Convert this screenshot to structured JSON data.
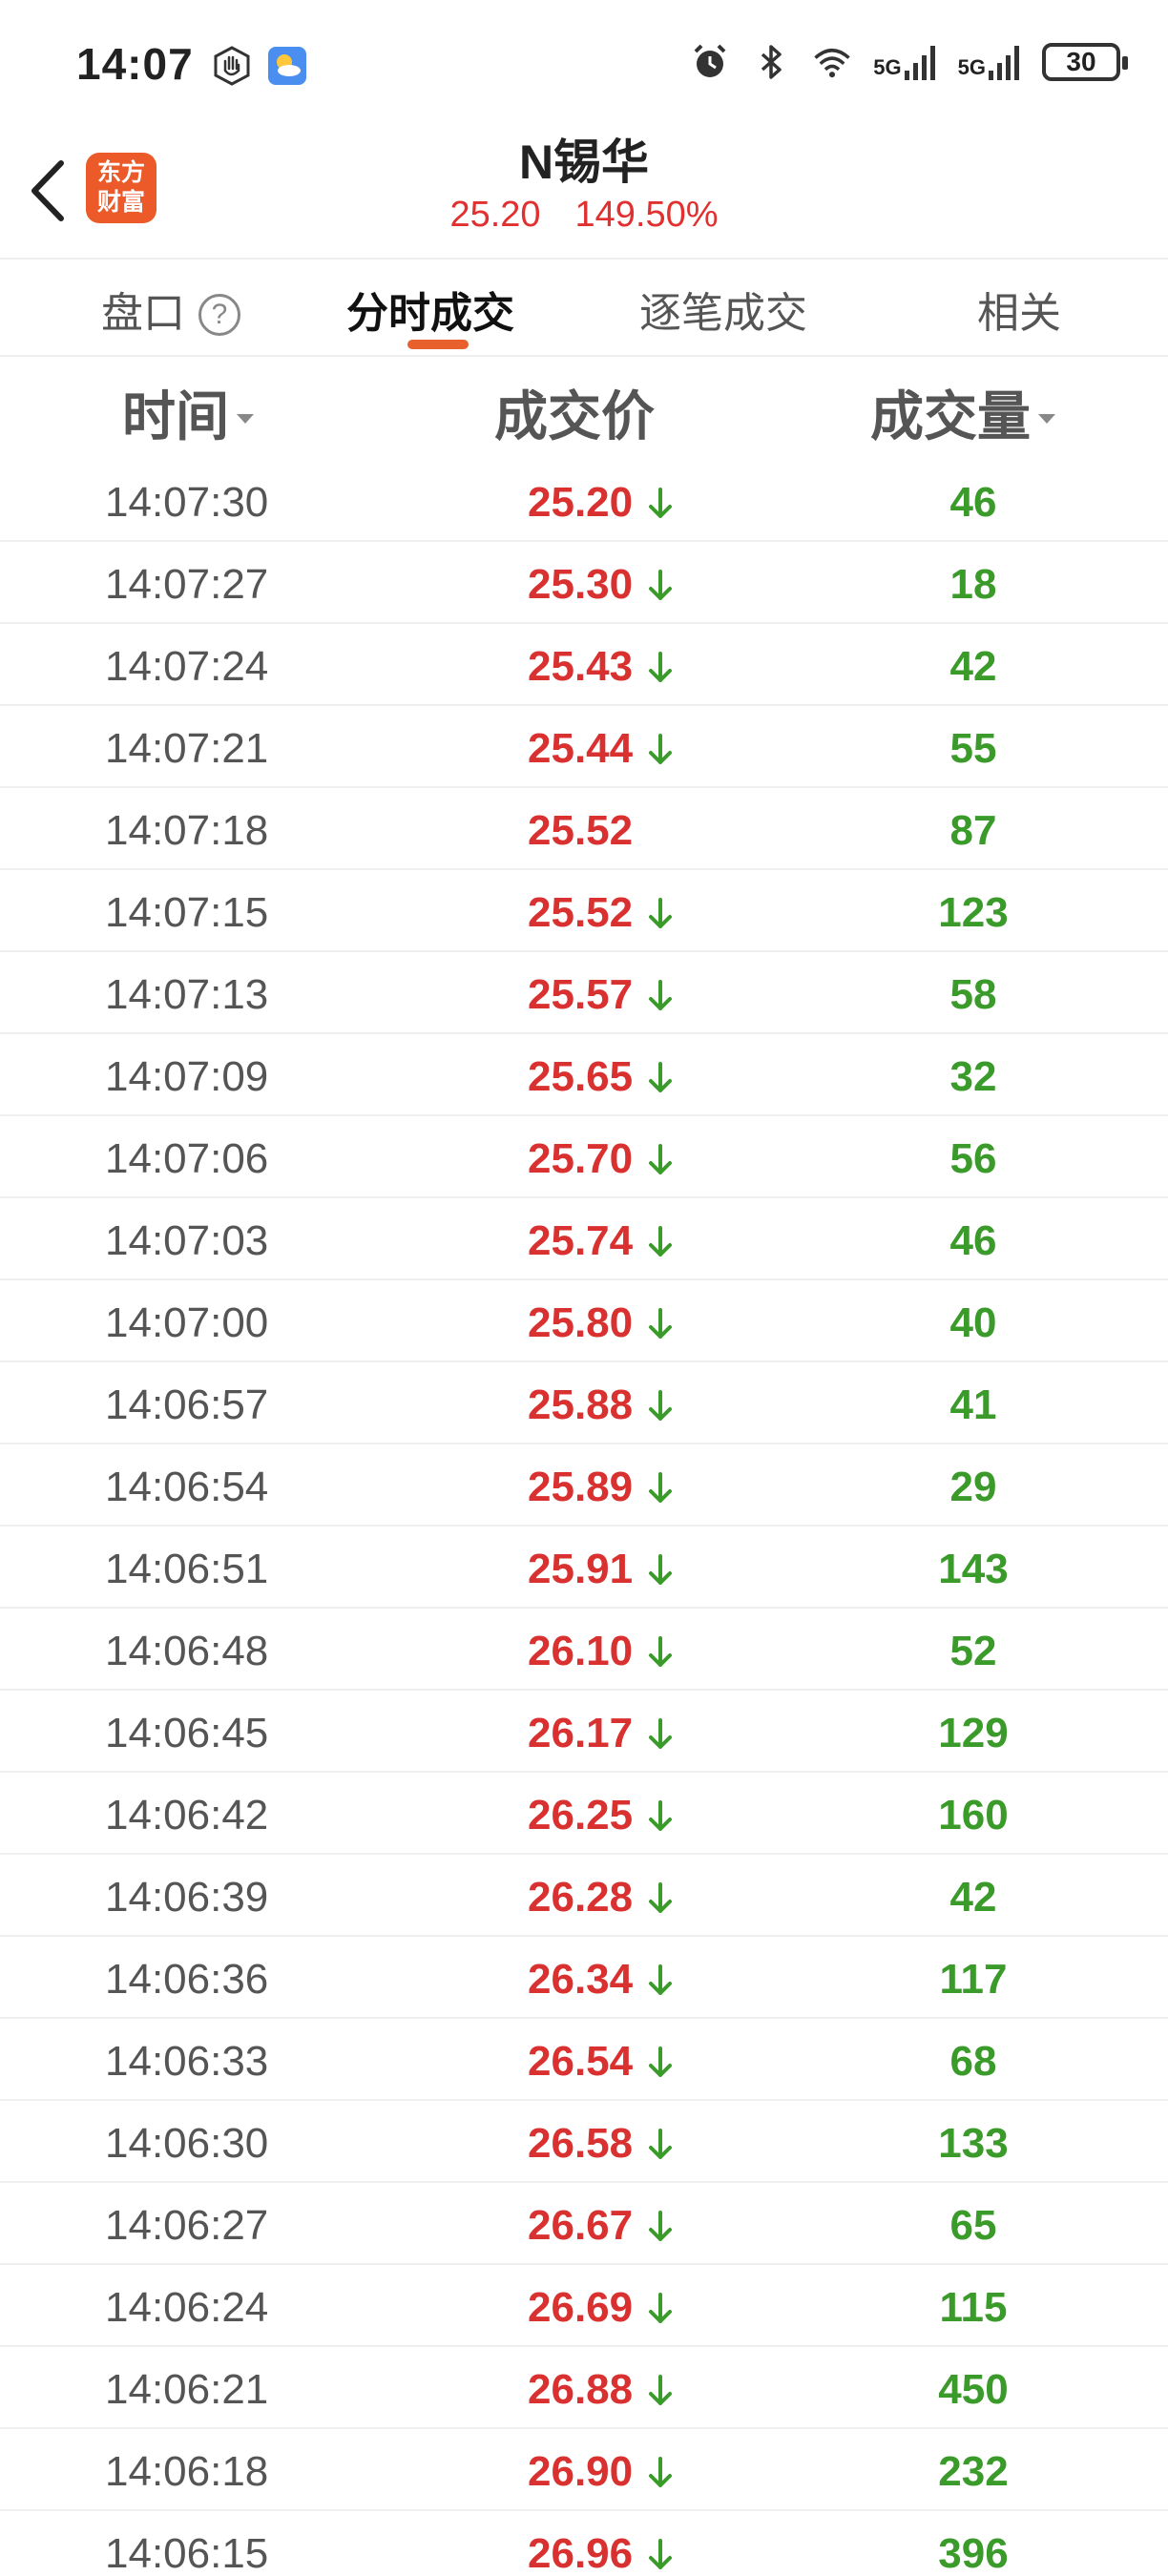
{
  "status_bar": {
    "time": "14:07",
    "signal1": "5G",
    "signal2": "5G",
    "battery": "30",
    "icons": [
      "hand-icon",
      "weather-icon",
      "alarm-icon",
      "bluetooth-icon",
      "wifi-icon"
    ]
  },
  "header": {
    "back_icon": "chevron-left-icon",
    "logo_line1": "东方",
    "logo_line2": "财富",
    "stock_name": "N锡华",
    "price": "25.20",
    "change_pct": "149.50%"
  },
  "tabs": [
    {
      "label": "盘口",
      "active": false
    },
    {
      "label": "分时成交",
      "active": true
    },
    {
      "label": "逐笔成交",
      "active": false
    },
    {
      "label": "相关",
      "active": false
    }
  ],
  "columns": {
    "time": "时间",
    "price": "成交价",
    "volume": "成交量"
  },
  "colors": {
    "up": "#d93030",
    "down": "#3a9a2a",
    "accent": "#e8602c"
  },
  "rows": [
    {
      "time": "14:07:30",
      "price": "25.20",
      "down": true,
      "volume": "46"
    },
    {
      "time": "14:07:27",
      "price": "25.30",
      "down": true,
      "volume": "18"
    },
    {
      "time": "14:07:24",
      "price": "25.43",
      "down": true,
      "volume": "42"
    },
    {
      "time": "14:07:21",
      "price": "25.44",
      "down": true,
      "volume": "55"
    },
    {
      "time": "14:07:18",
      "price": "25.52",
      "down": false,
      "volume": "87"
    },
    {
      "time": "14:07:15",
      "price": "25.52",
      "down": true,
      "volume": "123"
    },
    {
      "time": "14:07:13",
      "price": "25.57",
      "down": true,
      "volume": "58"
    },
    {
      "time": "14:07:09",
      "price": "25.65",
      "down": true,
      "volume": "32"
    },
    {
      "time": "14:07:06",
      "price": "25.70",
      "down": true,
      "volume": "56"
    },
    {
      "time": "14:07:03",
      "price": "25.74",
      "down": true,
      "volume": "46"
    },
    {
      "time": "14:07:00",
      "price": "25.80",
      "down": true,
      "volume": "40"
    },
    {
      "time": "14:06:57",
      "price": "25.88",
      "down": true,
      "volume": "41"
    },
    {
      "time": "14:06:54",
      "price": "25.89",
      "down": true,
      "volume": "29"
    },
    {
      "time": "14:06:51",
      "price": "25.91",
      "down": true,
      "volume": "143"
    },
    {
      "time": "14:06:48",
      "price": "26.10",
      "down": true,
      "volume": "52"
    },
    {
      "time": "14:06:45",
      "price": "26.17",
      "down": true,
      "volume": "129"
    },
    {
      "time": "14:06:42",
      "price": "26.25",
      "down": true,
      "volume": "160"
    },
    {
      "time": "14:06:39",
      "price": "26.28",
      "down": true,
      "volume": "42"
    },
    {
      "time": "14:06:36",
      "price": "26.34",
      "down": true,
      "volume": "117"
    },
    {
      "time": "14:06:33",
      "price": "26.54",
      "down": true,
      "volume": "68"
    },
    {
      "time": "14:06:30",
      "price": "26.58",
      "down": true,
      "volume": "133"
    },
    {
      "time": "14:06:27",
      "price": "26.67",
      "down": true,
      "volume": "65"
    },
    {
      "time": "14:06:24",
      "price": "26.69",
      "down": true,
      "volume": "115"
    },
    {
      "time": "14:06:21",
      "price": "26.88",
      "down": true,
      "volume": "450"
    },
    {
      "time": "14:06:18",
      "price": "26.90",
      "down": true,
      "volume": "232"
    },
    {
      "time": "14:06:15",
      "price": "26.96",
      "down": true,
      "volume": "396"
    }
  ]
}
